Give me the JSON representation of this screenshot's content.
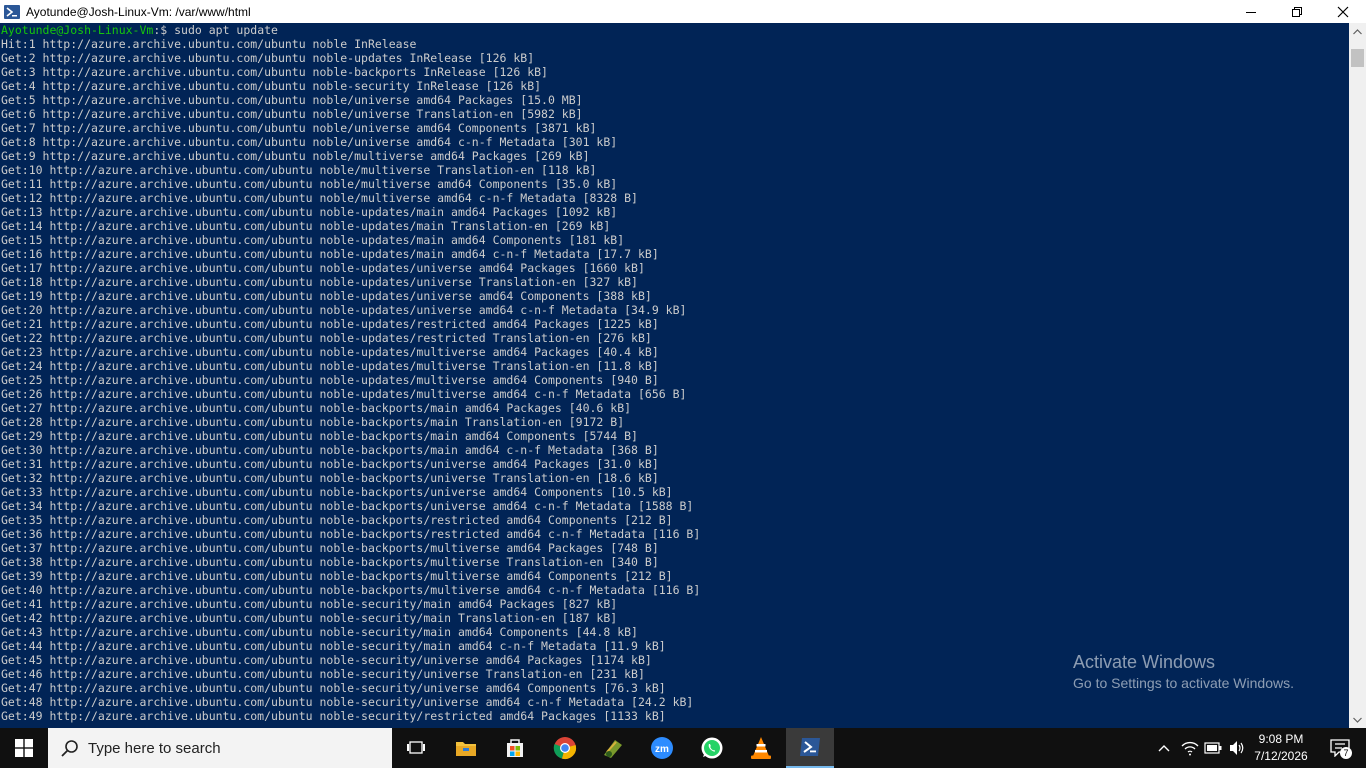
{
  "window": {
    "title": "Ayotunde@Josh-Linux-Vm: /var/www/html"
  },
  "console": {
    "prompt_user": "Ayotunde@Josh-Linux-Vm",
    "prompt_sep": ":",
    "prompt_path": " ",
    "prompt_rest": "$ sudo apt update",
    "lines": [
      "Hit:1 http://azure.archive.ubuntu.com/ubuntu noble InRelease",
      "Get:2 http://azure.archive.ubuntu.com/ubuntu noble-updates InRelease [126 kB]",
      "Get:3 http://azure.archive.ubuntu.com/ubuntu noble-backports InRelease [126 kB]",
      "Get:4 http://azure.archive.ubuntu.com/ubuntu noble-security InRelease [126 kB]",
      "Get:5 http://azure.archive.ubuntu.com/ubuntu noble/universe amd64 Packages [15.0 MB]",
      "Get:6 http://azure.archive.ubuntu.com/ubuntu noble/universe Translation-en [5982 kB]",
      "Get:7 http://azure.archive.ubuntu.com/ubuntu noble/universe amd64 Components [3871 kB]",
      "Get:8 http://azure.archive.ubuntu.com/ubuntu noble/universe amd64 c-n-f Metadata [301 kB]",
      "Get:9 http://azure.archive.ubuntu.com/ubuntu noble/multiverse amd64 Packages [269 kB]",
      "Get:10 http://azure.archive.ubuntu.com/ubuntu noble/multiverse Translation-en [118 kB]",
      "Get:11 http://azure.archive.ubuntu.com/ubuntu noble/multiverse amd64 Components [35.0 kB]",
      "Get:12 http://azure.archive.ubuntu.com/ubuntu noble/multiverse amd64 c-n-f Metadata [8328 B]",
      "Get:13 http://azure.archive.ubuntu.com/ubuntu noble-updates/main amd64 Packages [1092 kB]",
      "Get:14 http://azure.archive.ubuntu.com/ubuntu noble-updates/main Translation-en [269 kB]",
      "Get:15 http://azure.archive.ubuntu.com/ubuntu noble-updates/main amd64 Components [181 kB]",
      "Get:16 http://azure.archive.ubuntu.com/ubuntu noble-updates/main amd64 c-n-f Metadata [17.7 kB]",
      "Get:17 http://azure.archive.ubuntu.com/ubuntu noble-updates/universe amd64 Packages [1660 kB]",
      "Get:18 http://azure.archive.ubuntu.com/ubuntu noble-updates/universe Translation-en [327 kB]",
      "Get:19 http://azure.archive.ubuntu.com/ubuntu noble-updates/universe amd64 Components [388 kB]",
      "Get:20 http://azure.archive.ubuntu.com/ubuntu noble-updates/universe amd64 c-n-f Metadata [34.9 kB]",
      "Get:21 http://azure.archive.ubuntu.com/ubuntu noble-updates/restricted amd64 Packages [1225 kB]",
      "Get:22 http://azure.archive.ubuntu.com/ubuntu noble-updates/restricted Translation-en [276 kB]",
      "Get:23 http://azure.archive.ubuntu.com/ubuntu noble-updates/multiverse amd64 Packages [40.4 kB]",
      "Get:24 http://azure.archive.ubuntu.com/ubuntu noble-updates/multiverse Translation-en [11.8 kB]",
      "Get:25 http://azure.archive.ubuntu.com/ubuntu noble-updates/multiverse amd64 Components [940 B]",
      "Get:26 http://azure.archive.ubuntu.com/ubuntu noble-updates/multiverse amd64 c-n-f Metadata [656 B]",
      "Get:27 http://azure.archive.ubuntu.com/ubuntu noble-backports/main amd64 Packages [40.6 kB]",
      "Get:28 http://azure.archive.ubuntu.com/ubuntu noble-backports/main Translation-en [9172 B]",
      "Get:29 http://azure.archive.ubuntu.com/ubuntu noble-backports/main amd64 Components [5744 B]",
      "Get:30 http://azure.archive.ubuntu.com/ubuntu noble-backports/main amd64 c-n-f Metadata [368 B]",
      "Get:31 http://azure.archive.ubuntu.com/ubuntu noble-backports/universe amd64 Packages [31.0 kB]",
      "Get:32 http://azure.archive.ubuntu.com/ubuntu noble-backports/universe Translation-en [18.6 kB]",
      "Get:33 http://azure.archive.ubuntu.com/ubuntu noble-backports/universe amd64 Components [10.5 kB]",
      "Get:34 http://azure.archive.ubuntu.com/ubuntu noble-backports/universe amd64 c-n-f Metadata [1588 B]",
      "Get:35 http://azure.archive.ubuntu.com/ubuntu noble-backports/restricted amd64 Components [212 B]",
      "Get:36 http://azure.archive.ubuntu.com/ubuntu noble-backports/restricted amd64 c-n-f Metadata [116 B]",
      "Get:37 http://azure.archive.ubuntu.com/ubuntu noble-backports/multiverse amd64 Packages [748 B]",
      "Get:38 http://azure.archive.ubuntu.com/ubuntu noble-backports/multiverse Translation-en [340 B]",
      "Get:39 http://azure.archive.ubuntu.com/ubuntu noble-backports/multiverse amd64 Components [212 B]",
      "Get:40 http://azure.archive.ubuntu.com/ubuntu noble-backports/multiverse amd64 c-n-f Metadata [116 B]",
      "Get:41 http://azure.archive.ubuntu.com/ubuntu noble-security/main amd64 Packages [827 kB]",
      "Get:42 http://azure.archive.ubuntu.com/ubuntu noble-security/main Translation-en [187 kB]",
      "Get:43 http://azure.archive.ubuntu.com/ubuntu noble-security/main amd64 Components [44.8 kB]",
      "Get:44 http://azure.archive.ubuntu.com/ubuntu noble-security/main amd64 c-n-f Metadata [11.9 kB]",
      "Get:45 http://azure.archive.ubuntu.com/ubuntu noble-security/universe amd64 Packages [1174 kB]",
      "Get:46 http://azure.archive.ubuntu.com/ubuntu noble-security/universe Translation-en [231 kB]",
      "Get:47 http://azure.archive.ubuntu.com/ubuntu noble-security/universe amd64 Components [76.3 kB]",
      "Get:48 http://azure.archive.ubuntu.com/ubuntu noble-security/universe amd64 c-n-f Metadata [24.2 kB]",
      "Get:49 http://azure.archive.ubuntu.com/ubuntu noble-security/restricted amd64 Packages [1133 kB]"
    ]
  },
  "watermark": {
    "title": "Activate Windows",
    "subtitle": "Go to Settings to activate Windows."
  },
  "taskbar": {
    "search_placeholder": "Type here to search",
    "zoom_label": "zm",
    "time": "9:08 PM",
    "date": "7/12/2026",
    "notification_count": "7"
  },
  "colors": {
    "console_bg": "#012456",
    "prompt_user": "#16c60c",
    "taskbar_bg": "#101010"
  }
}
